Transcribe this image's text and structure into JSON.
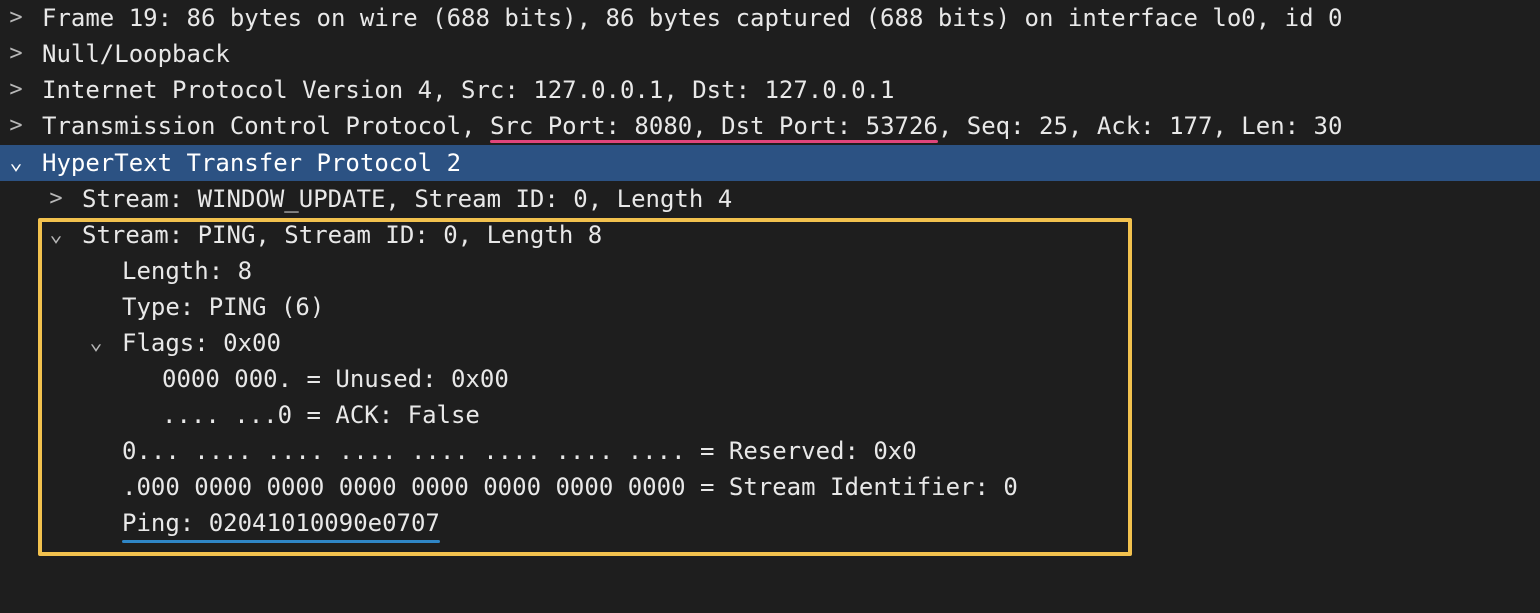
{
  "colors": {
    "background": "#1e1e1e",
    "selected_row": "#2c5283",
    "highlight_box": "#f2c14e",
    "underline_ports": "#e0457b",
    "underline_ping": "#2f86c6"
  },
  "icons": {
    "collapsed": "chevron-right-icon",
    "expanded": "chevron-down-icon"
  },
  "rows": {
    "frame": {
      "toggle": ">",
      "text": "Frame 19: 86 bytes on wire (688 bits), 86 bytes captured (688 bits) on interface lo0, id 0"
    },
    "null_loopback": {
      "toggle": ">",
      "text": "Null/Loopback"
    },
    "ipv4": {
      "toggle": ">",
      "text": "Internet Protocol Version 4, Src: 127.0.0.1, Dst: 127.0.0.1"
    },
    "tcp": {
      "toggle": ">",
      "prefix": "Transmission Control Protocol, ",
      "ports": "Src Port: 8080, Dst Port: 53726",
      "suffix": ", Seq: 25, Ack: 177, Len: 30"
    },
    "http2": {
      "toggle": "⌄",
      "text": "HyperText Transfer Protocol 2"
    },
    "stream_window_update": {
      "toggle": ">",
      "text": "Stream: WINDOW_UPDATE, Stream ID: 0, Length 4"
    },
    "stream_ping": {
      "toggle": "⌄",
      "text": "Stream: PING, Stream ID: 0, Length 8"
    },
    "length": {
      "text": "Length: 8"
    },
    "type": {
      "text": "Type: PING (6)"
    },
    "flags": {
      "toggle": "⌄",
      "text": "Flags: 0x00"
    },
    "flags_unused": {
      "text": "0000 000. = Unused: 0x00"
    },
    "flags_ack": {
      "text": ".... ...0 = ACK: False"
    },
    "reserved": {
      "text": "0... .... .... .... .... .... .... .... = Reserved: 0x0"
    },
    "stream_identifier": {
      "text": ".000 0000 0000 0000 0000 0000 0000 0000 = Stream Identifier: 0"
    },
    "ping": {
      "text": "Ping: 02041010090e0707"
    }
  }
}
